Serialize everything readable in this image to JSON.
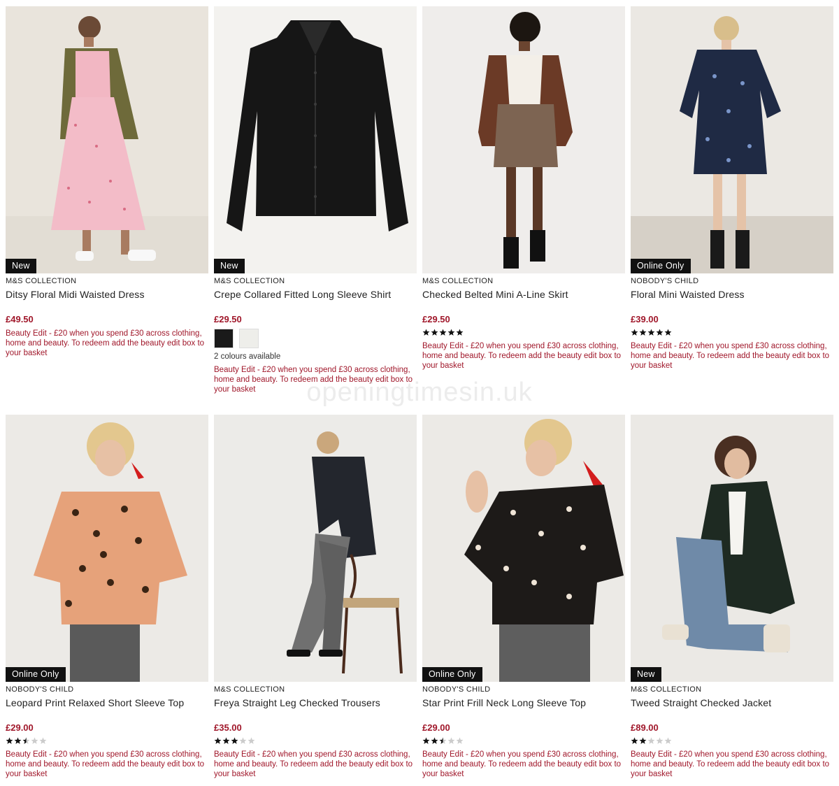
{
  "watermark": "openingtimesin.uk",
  "colors": {
    "price": "#a0172a",
    "badge_bg": "#111111",
    "star": "#111111",
    "star_empty": "#cccccc"
  },
  "products": [
    {
      "badge": "New",
      "brand": "M&S COLLECTION",
      "title": "Ditsy Floral Midi Waisted Dress",
      "price": "£49.50",
      "rating": 0,
      "colours_text": "",
      "swatches": [],
      "promo": "Beauty Edit - £20 when you spend £30 across clothing, home and beauty. To redeem add the beauty edit box to your basket",
      "image": "woman-pink-floral-dress-khaki-jacket"
    },
    {
      "badge": "New",
      "brand": "M&S COLLECTION",
      "title": "Crepe Collared Fitted Long Sleeve Shirt",
      "price": "£29.50",
      "rating": 0,
      "colours_text": "2 colours available",
      "swatches": [
        "#1a1a1a",
        "#eeeeea"
      ],
      "promo": "Beauty Edit - £20 when you spend £30 across clothing, home and beauty. To redeem add the beauty edit box to your basket",
      "image": "black-shirt"
    },
    {
      "badge": "",
      "brand": "M&S COLLECTION",
      "title": "Checked Belted Mini A-Line Skirt",
      "price": "£29.50",
      "rating": 5,
      "colours_text": "",
      "swatches": [],
      "promo": "Beauty Edit - £20 when you spend £30 across clothing, home and beauty. To redeem add the beauty edit box to your basket",
      "image": "woman-brown-jacket-checked-skirt"
    },
    {
      "badge": "Online Only",
      "brand": "NOBODY'S CHILD",
      "title": "Floral Mini Waisted Dress",
      "price": "£39.00",
      "rating": 5,
      "colours_text": "",
      "swatches": [],
      "promo": "Beauty Edit - £20 when you spend £30 across clothing, home and beauty. To redeem add the beauty edit box to your basket",
      "image": "woman-blue-floral-mini-dress"
    },
    {
      "badge": "Online Only",
      "brand": "NOBODY'S CHILD",
      "title": "Leopard Print Relaxed Short Sleeve Top",
      "price": "£29.00",
      "rating": 2.5,
      "colours_text": "",
      "swatches": [],
      "promo": "Beauty Edit - £20 when you spend £30 across clothing, home and beauty. To redeem add the beauty edit box to your basket",
      "image": "woman-leopard-top"
    },
    {
      "badge": "",
      "brand": "M&S COLLECTION",
      "title": "Freya Straight Leg Checked Trousers",
      "price": "£35.00",
      "rating": 3,
      "colours_text": "",
      "swatches": [],
      "promo": "Beauty Edit - £20 when you spend £30 across clothing, home and beauty. To redeem add the beauty edit box to your basket",
      "image": "woman-checked-trousers-chair"
    },
    {
      "badge": "Online Only",
      "brand": "NOBODY'S CHILD",
      "title": "Star Print Frill Neck Long Sleeve Top",
      "price": "£29.00",
      "rating": 2.5,
      "colours_text": "",
      "swatches": [],
      "promo": "Beauty Edit - £20 when you spend £30 across clothing, home and beauty. To redeem add the beauty edit box to your basket",
      "image": "woman-star-print-top"
    },
    {
      "badge": "New",
      "brand": "M&S COLLECTION",
      "title": "Tweed Straight Checked Jacket",
      "price": "£89.00",
      "rating": 2,
      "colours_text": "",
      "swatches": [],
      "promo": "Beauty Edit - £20 when you spend £30 across clothing, home and beauty. To redeem add the beauty edit box to your basket",
      "image": "woman-tweed-jacket-crouching"
    }
  ]
}
